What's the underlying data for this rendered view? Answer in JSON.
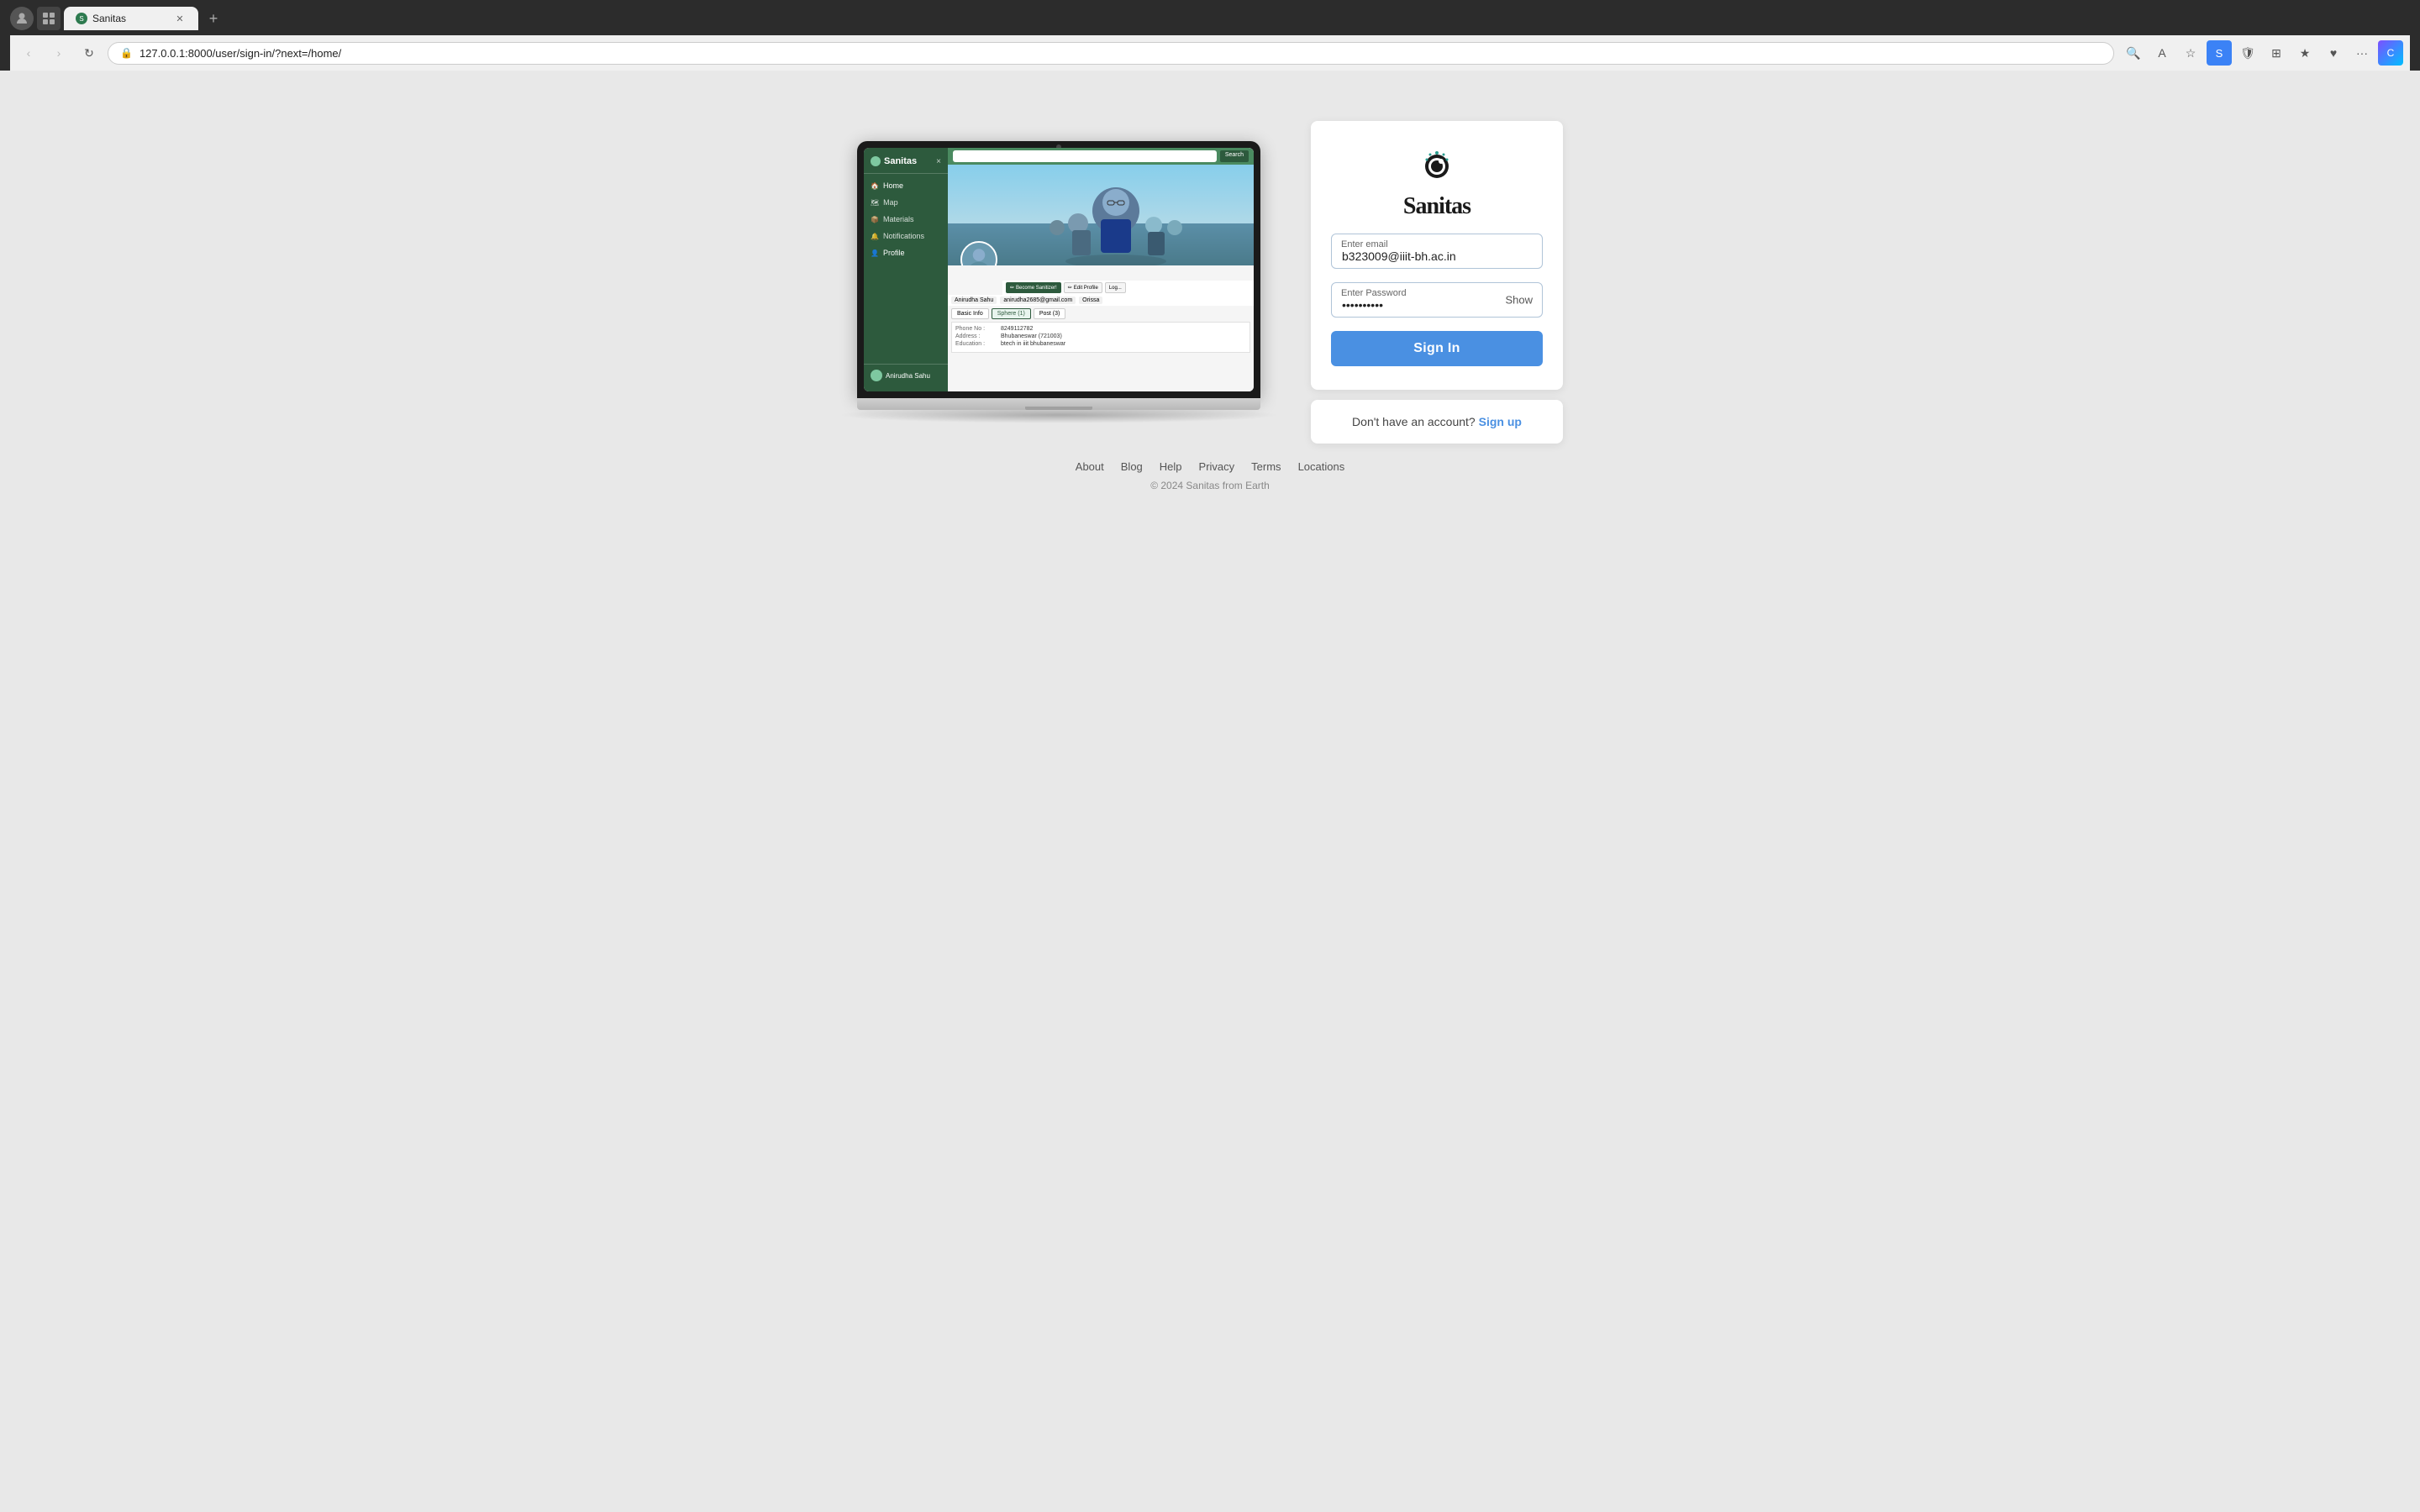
{
  "browser": {
    "tab_title": "Sanitas",
    "url": "127.0.0.1:8000/user/sign-in/?next=/home/"
  },
  "sidebar": {
    "title": "Sanitas",
    "close": "×",
    "items": [
      {
        "icon": "🏠",
        "label": "Home"
      },
      {
        "icon": "🗺",
        "label": "Map"
      },
      {
        "icon": "📦",
        "label": "Materials"
      },
      {
        "icon": "🔔",
        "label": "Notifications"
      },
      {
        "icon": "👤",
        "label": "Profile"
      }
    ],
    "footer_name": "Anirudha Sahu"
  },
  "profile": {
    "name": "Anirudha Sahu",
    "email": "anirudha2685@gmail.com",
    "location": "Orissa",
    "phone": "8249112782",
    "address": "Bhubaneswar (721003)",
    "education": "btech in iiit bhubaneswar",
    "sphere": "Sphere (1)",
    "post": "Post (3)",
    "actions": {
      "sanitizer": "Become Sanitizer!",
      "edit": "Edit Profile",
      "logout": "Log..."
    }
  },
  "login": {
    "logo_text": "Sanitas",
    "email_label": "Enter email",
    "email_value": "b323009@iiit-bh.ac.in",
    "password_label": "Enter Password",
    "password_value": "••••••••••",
    "show_label": "Show",
    "sign_in_label": "Sign In",
    "no_account_text": "Don't have an account?",
    "sign_up_label": "Sign up"
  },
  "footer": {
    "links": [
      "About",
      "Blog",
      "Help",
      "Privacy",
      "Terms",
      "Locations"
    ],
    "copyright": "© 2024 Sanitas from Earth"
  }
}
